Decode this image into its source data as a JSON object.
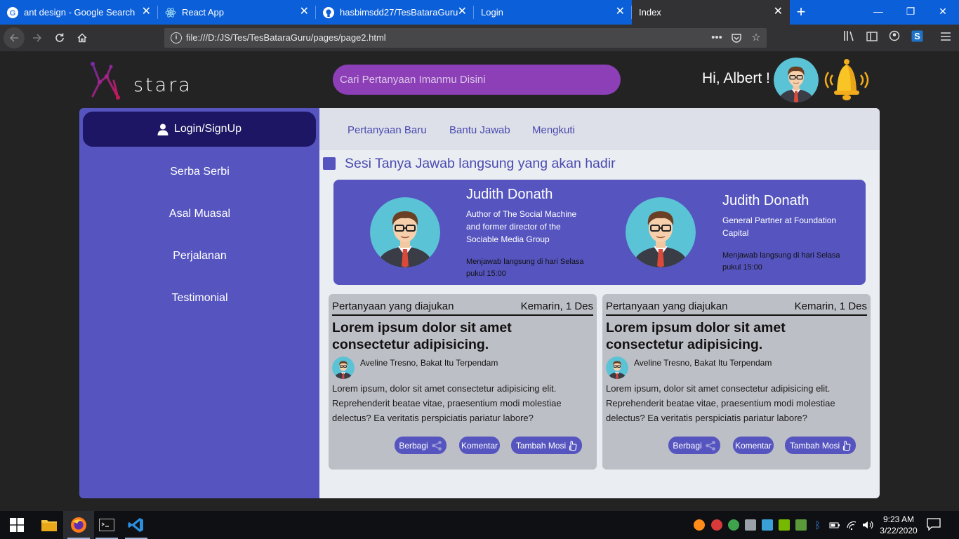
{
  "browser": {
    "tabs": [
      {
        "title": "ant design - Google Search",
        "icon": "google-icon"
      },
      {
        "title": "React App",
        "icon": "react-icon"
      },
      {
        "title": "hasbimsdd27/TesBataraGuru",
        "icon": "github-icon"
      },
      {
        "title": "Login",
        "icon": "none"
      },
      {
        "title": "Index",
        "icon": "none",
        "active": true
      }
    ],
    "url": "file:///D:/JS/Tes/TesBataraGuru/pages/page2.html"
  },
  "header": {
    "logo_text": "stara",
    "search_placeholder": "Cari Pertanyaan Imanmu Disini",
    "greeting": "Hi, Albert !"
  },
  "sidebar": {
    "login_label": "Login/SignUp",
    "items": [
      "Serba Serbi",
      "Asal Muasal",
      "Perjalanan",
      "Testimonial"
    ]
  },
  "main": {
    "tabs": [
      "Pertanyaan Baru",
      "Bantu Jawab",
      "Mengkuti"
    ],
    "section_title": "Sesi Tanya Jawab langsung yang akan hadir",
    "speakers": [
      {
        "name": "Judith Donath",
        "desc": "Author of The Social Machine and former director of the Sociable Media Group",
        "when": "Menjawab langsung di hari Selasa pukul 15:00"
      },
      {
        "name": "Judith Donath",
        "desc": "General Partner at Foundation Capital",
        "when": "Menjawab langsung di hari Selasa pukul 15:00"
      }
    ],
    "cards": [
      {
        "label": "Pertanyaan yang diajukan",
        "date": "Kemarin, 1 Des",
        "title": "Lorem ipsum dolor sit amet consectetur adipisicing.",
        "author": "Aveline Tresno, Bakat Itu Terpendam",
        "body": "Lorem ipsum, dolor sit amet consectetur adipisicing elit. Reprehenderit beatae vitae, praesentium modi molestiae delectus? Ea veritatis perspiciatis pariatur labore?",
        "actions": [
          "Berbagi",
          "Komentar",
          "Tambah Mosi"
        ]
      },
      {
        "label": "Pertanyaan yang diajukan",
        "date": "Kemarin, 1 Des",
        "title": "Lorem ipsum dolor sit amet consectetur adipisicing.",
        "author": "Aveline Tresno, Bakat Itu Terpendam",
        "body": "Lorem ipsum, dolor sit amet consectetur adipisicing elit. Reprehenderit beatae vitae, praesentium modi molestiae delectus? Ea veritatis perspiciatis pariatur labore?",
        "actions": [
          "Berbagi",
          "Komentar",
          "Tambah Mosi"
        ]
      }
    ]
  },
  "taskbar": {
    "time": "9:23 AM",
    "date": "3/22/2020"
  },
  "colors": {
    "accent": "#5655c0",
    "accent_dark": "#1d1664",
    "search_bg": "#8c3fb6",
    "page_bg": "#232324",
    "chrome_blue": "#0b5fd8"
  }
}
